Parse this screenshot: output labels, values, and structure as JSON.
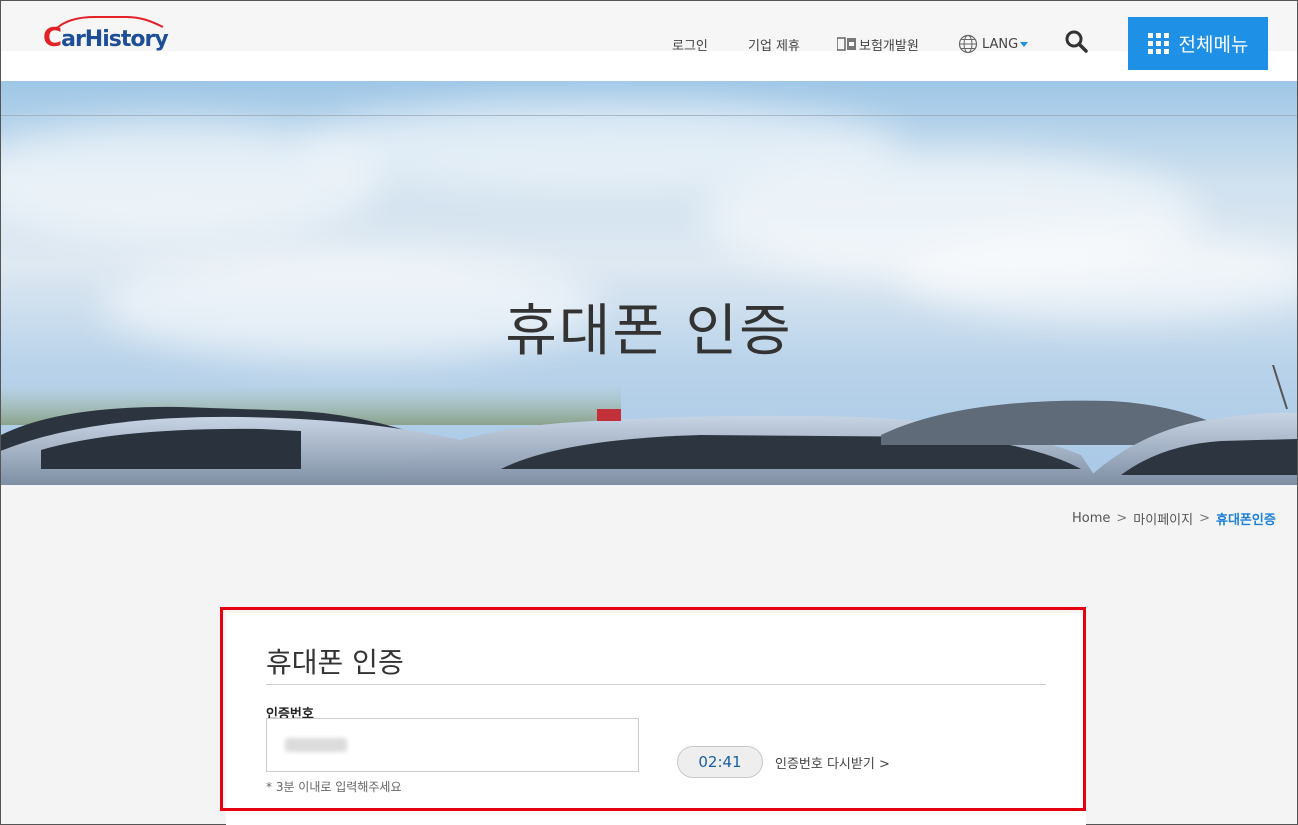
{
  "header": {
    "logo_text": "CarHistory",
    "nav": {
      "login": "로그인",
      "partner": "기업 제휴",
      "kidi": "보험개발원",
      "lang": "LANG"
    },
    "menu_label": "전체메뉴"
  },
  "hero": {
    "title": "휴대폰 인증"
  },
  "breadcrumb": {
    "home": "Home",
    "mypage": "마이페이지",
    "current": "휴대폰인증"
  },
  "form": {
    "title": "휴대폰 인증",
    "code_label": "인증번호",
    "code_value": "",
    "hint": "* 3분 이내로 입력해주세요",
    "timer": "02:41",
    "resend_label": "인증번호 다시받기 >"
  },
  "colors": {
    "accent": "#1e90e6",
    "highlight": "#e50012",
    "breadcrumb_current": "#1e80d6"
  }
}
